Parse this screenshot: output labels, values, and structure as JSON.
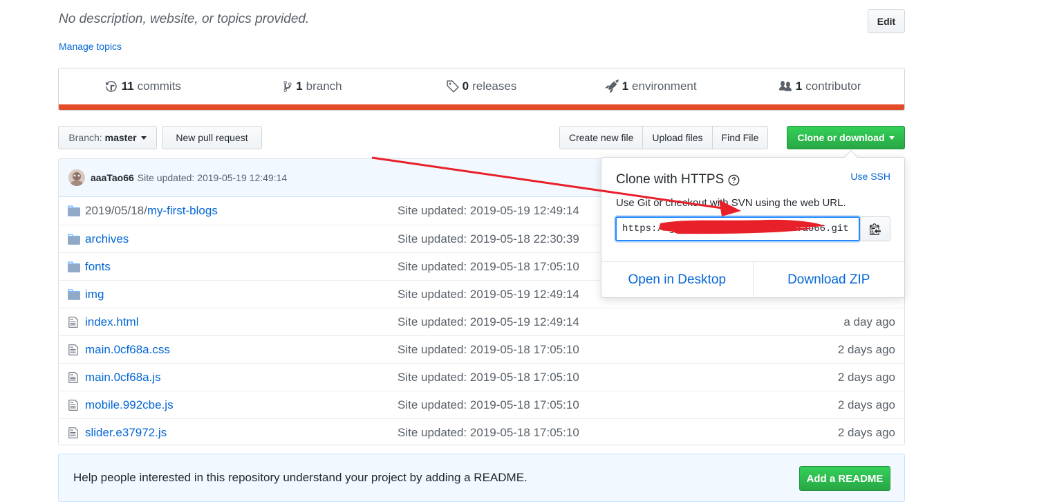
{
  "repo": {
    "description": "No description, website, or topics provided.",
    "manage_topics": "Manage topics",
    "edit_label": "Edit"
  },
  "summary": {
    "commits": {
      "count": "11",
      "label": "commits"
    },
    "branches": {
      "count": "1",
      "label": "branch"
    },
    "releases": {
      "count": "0",
      "label": "releases"
    },
    "environments": {
      "count": "1",
      "label": "environment"
    },
    "contributors": {
      "count": "1",
      "label": "contributor"
    },
    "language_color": "#e34c26"
  },
  "toolbar": {
    "branch_prefix": "Branch:",
    "branch_name": "master",
    "new_pull_request": "New pull request",
    "create_new_file": "Create new file",
    "upload_files": "Upload files",
    "find_file": "Find File",
    "clone_or_download": "Clone or download"
  },
  "latest_commit": {
    "author": "aaaTao66",
    "message": "Site updated: 2019-05-19 12:49:14"
  },
  "files": [
    {
      "type": "folder",
      "path_prefix": "2019/05/18/",
      "name": "my-first-blogs",
      "message": "Site updated: 2019-05-19 12:49:14",
      "age": ""
    },
    {
      "type": "folder",
      "path_prefix": "",
      "name": "archives",
      "message": "Site updated: 2019-05-18 22:30:39",
      "age": ""
    },
    {
      "type": "folder",
      "path_prefix": "",
      "name": "fonts",
      "message": "Site updated: 2019-05-18 17:05:10",
      "age": ""
    },
    {
      "type": "folder",
      "path_prefix": "",
      "name": "img",
      "message": "Site updated: 2019-05-19 12:49:14",
      "age": ""
    },
    {
      "type": "file",
      "path_prefix": "",
      "name": "index.html",
      "message": "Site updated: 2019-05-19 12:49:14",
      "age": "a day ago"
    },
    {
      "type": "file",
      "path_prefix": "",
      "name": "main.0cf68a.css",
      "message": "Site updated: 2019-05-18 17:05:10",
      "age": "2 days ago"
    },
    {
      "type": "file",
      "path_prefix": "",
      "name": "main.0cf68a.js",
      "message": "Site updated: 2019-05-18 17:05:10",
      "age": "2 days ago"
    },
    {
      "type": "file",
      "path_prefix": "",
      "name": "mobile.992cbe.js",
      "message": "Site updated: 2019-05-18 17:05:10",
      "age": "2 days ago"
    },
    {
      "type": "file",
      "path_prefix": "",
      "name": "slider.e37972.js",
      "message": "Site updated: 2019-05-18 17:05:10",
      "age": "2 days ago"
    }
  ],
  "readme": {
    "prompt": "Help people interested in this repository understand your project by adding a README.",
    "button": "Add a README"
  },
  "clone_popup": {
    "title": "Clone with HTTPS",
    "use_ssh": "Use SSH",
    "subtitle": "Use Git or checkout with SVN using the web URL.",
    "url_value": "https://gitee.com/aaaTao66/aaaTao66.git",
    "open_desktop": "Open in Desktop",
    "download_zip": "Download ZIP"
  },
  "annotation": {
    "color": "#e8202a"
  }
}
